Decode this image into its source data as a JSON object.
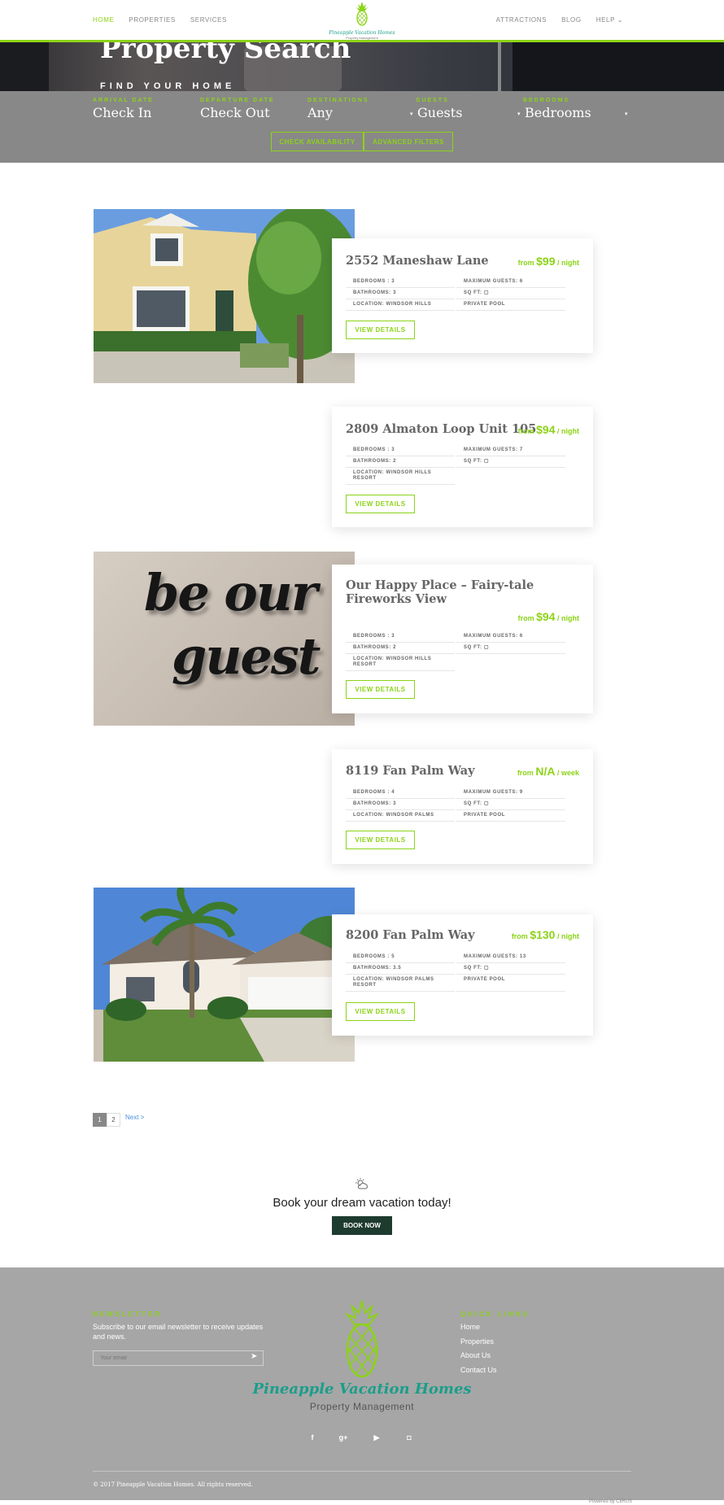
{
  "nav": {
    "left": [
      "HOME",
      "PROPERTIES",
      "SERVICES"
    ],
    "right": [
      "ATTRACTIONS",
      "BLOG",
      "HELP"
    ],
    "logo_name": "Pineapple Vacation Homes",
    "logo_sub": "Property Management"
  },
  "hero": {
    "title": "Property Search",
    "subtitle": "FIND YOUR HOME"
  },
  "search": {
    "fields": [
      {
        "label": "ARRIVAL DATE",
        "value": "Check In"
      },
      {
        "label": "DEPARTURE DATE",
        "value": "Check Out"
      },
      {
        "label": "DESTINATIONS",
        "value": "Any"
      },
      {
        "label": "GUESTS",
        "value": "Guests"
      },
      {
        "label": "BEDROOMS",
        "value": "Bedrooms"
      }
    ],
    "check_availability": "CHECK AVAILABILITY",
    "advanced_filters": "ADVANCED FILTERS"
  },
  "listings": [
    {
      "title": "2552 Maneshaw Lane",
      "price_from": "from",
      "price": "$99",
      "price_unit": "/ night",
      "specs": [
        "BEDROOMS : 3",
        "MAXIMUM GUESTS: 6",
        "BATHROOMS: 3",
        "SQ FT: ▢",
        "LOCATION: WINDSOR HILLS",
        "PRIVATE POOL"
      ],
      "button": "VIEW DETAILS"
    },
    {
      "title": "2809 Almaton Loop Unit 105",
      "price_from": "from",
      "price": "$94",
      "price_unit": "/ night",
      "specs": [
        "BEDROOMS : 3",
        "MAXIMUM GUESTS: 7",
        "BATHROOMS: 2",
        "SQ FT: ▢",
        "LOCATION: WINDSOR HILLS RESORT"
      ],
      "button": "VIEW DETAILS"
    },
    {
      "title": "Our Happy Place – Fairy-tale Fireworks View",
      "price_from": "from",
      "price": "$94",
      "price_unit": "/ night",
      "specs": [
        "BEDROOMS : 3",
        "MAXIMUM GUESTS: 6",
        "BATHROOMS: 2",
        "SQ FT: ▢",
        "LOCATION: WINDSOR HILLS RESORT"
      ],
      "button": "VIEW DETAILS",
      "photo_text_1": "be our",
      "photo_text_2": "guest"
    },
    {
      "title": "8119 Fan Palm Way",
      "price_from": "from",
      "price": "N/A",
      "price_unit": "/ week",
      "specs": [
        "BEDROOMS : 4",
        "MAXIMUM GUESTS: 9",
        "BATHROOMS: 3",
        "SQ FT: ▢",
        "LOCATION: WINDSOR PALMS",
        "PRIVATE POOL"
      ],
      "button": "VIEW DETAILS"
    },
    {
      "title": "8200 Fan Palm Way",
      "price_from": "from",
      "price": "$130",
      "price_unit": "/ night",
      "specs": [
        "BEDROOMS : 5",
        "MAXIMUM GUESTS: 13",
        "BATHROOMS: 3.5",
        "SQ FT: ▢",
        "LOCATION: WINDSOR PALMS RESORT",
        "PRIVATE POOL"
      ],
      "button": "VIEW DETAILS"
    }
  ],
  "pagination": {
    "pages": [
      "1",
      "2"
    ],
    "next": "Next >"
  },
  "cta": {
    "text": "Book your dream vacation today!",
    "button": "BOOK NOW"
  },
  "footer": {
    "newsletter_head": "NEWSLETTER",
    "newsletter_text": "Subscribe to our email newsletter to receive updates and news.",
    "email_placeholder": "Your email",
    "quick_links_head": "QUICK LINKS",
    "links": [
      "Home",
      "Properties",
      "About Us",
      "Contact Us"
    ],
    "logo_name": "Pineapple Vacation Homes",
    "logo_sub": "Property Management",
    "social": [
      "f",
      "g+",
      "▶",
      "◘"
    ],
    "copyright": "© 2017 Pineapple Vacation Homes. All rights reserved.",
    "powered": "Powered by CiiRUS"
  },
  "colors": {
    "accent": "#8cd317",
    "brand_teal": "#1a9e8a",
    "cta_dark": "#1e3b2f"
  }
}
